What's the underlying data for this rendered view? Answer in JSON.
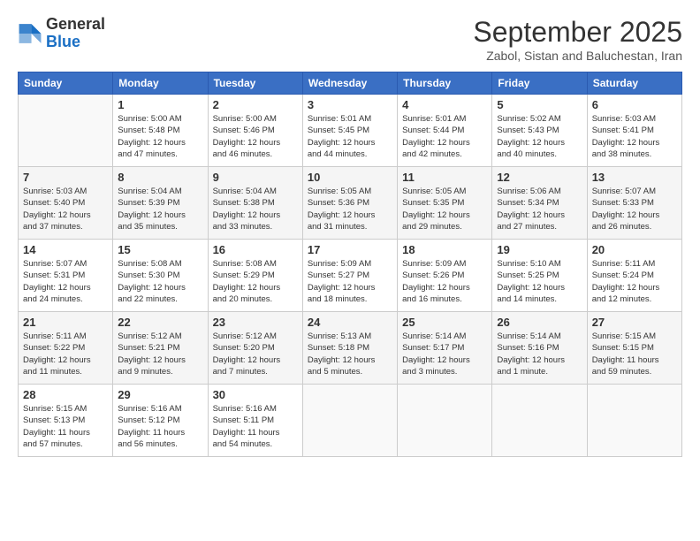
{
  "logo": {
    "line1": "General",
    "line2": "Blue"
  },
  "title": "September 2025",
  "location": "Zabol, Sistan and Baluchestan, Iran",
  "weekdays": [
    "Sunday",
    "Monday",
    "Tuesday",
    "Wednesday",
    "Thursday",
    "Friday",
    "Saturday"
  ],
  "weeks": [
    [
      {
        "day": "",
        "info": ""
      },
      {
        "day": "1",
        "info": "Sunrise: 5:00 AM\nSunset: 5:48 PM\nDaylight: 12 hours\nand 47 minutes."
      },
      {
        "day": "2",
        "info": "Sunrise: 5:00 AM\nSunset: 5:46 PM\nDaylight: 12 hours\nand 46 minutes."
      },
      {
        "day": "3",
        "info": "Sunrise: 5:01 AM\nSunset: 5:45 PM\nDaylight: 12 hours\nand 44 minutes."
      },
      {
        "day": "4",
        "info": "Sunrise: 5:01 AM\nSunset: 5:44 PM\nDaylight: 12 hours\nand 42 minutes."
      },
      {
        "day": "5",
        "info": "Sunrise: 5:02 AM\nSunset: 5:43 PM\nDaylight: 12 hours\nand 40 minutes."
      },
      {
        "day": "6",
        "info": "Sunrise: 5:03 AM\nSunset: 5:41 PM\nDaylight: 12 hours\nand 38 minutes."
      }
    ],
    [
      {
        "day": "7",
        "info": "Sunrise: 5:03 AM\nSunset: 5:40 PM\nDaylight: 12 hours\nand 37 minutes."
      },
      {
        "day": "8",
        "info": "Sunrise: 5:04 AM\nSunset: 5:39 PM\nDaylight: 12 hours\nand 35 minutes."
      },
      {
        "day": "9",
        "info": "Sunrise: 5:04 AM\nSunset: 5:38 PM\nDaylight: 12 hours\nand 33 minutes."
      },
      {
        "day": "10",
        "info": "Sunrise: 5:05 AM\nSunset: 5:36 PM\nDaylight: 12 hours\nand 31 minutes."
      },
      {
        "day": "11",
        "info": "Sunrise: 5:05 AM\nSunset: 5:35 PM\nDaylight: 12 hours\nand 29 minutes."
      },
      {
        "day": "12",
        "info": "Sunrise: 5:06 AM\nSunset: 5:34 PM\nDaylight: 12 hours\nand 27 minutes."
      },
      {
        "day": "13",
        "info": "Sunrise: 5:07 AM\nSunset: 5:33 PM\nDaylight: 12 hours\nand 26 minutes."
      }
    ],
    [
      {
        "day": "14",
        "info": "Sunrise: 5:07 AM\nSunset: 5:31 PM\nDaylight: 12 hours\nand 24 minutes."
      },
      {
        "day": "15",
        "info": "Sunrise: 5:08 AM\nSunset: 5:30 PM\nDaylight: 12 hours\nand 22 minutes."
      },
      {
        "day": "16",
        "info": "Sunrise: 5:08 AM\nSunset: 5:29 PM\nDaylight: 12 hours\nand 20 minutes."
      },
      {
        "day": "17",
        "info": "Sunrise: 5:09 AM\nSunset: 5:27 PM\nDaylight: 12 hours\nand 18 minutes."
      },
      {
        "day": "18",
        "info": "Sunrise: 5:09 AM\nSunset: 5:26 PM\nDaylight: 12 hours\nand 16 minutes."
      },
      {
        "day": "19",
        "info": "Sunrise: 5:10 AM\nSunset: 5:25 PM\nDaylight: 12 hours\nand 14 minutes."
      },
      {
        "day": "20",
        "info": "Sunrise: 5:11 AM\nSunset: 5:24 PM\nDaylight: 12 hours\nand 12 minutes."
      }
    ],
    [
      {
        "day": "21",
        "info": "Sunrise: 5:11 AM\nSunset: 5:22 PM\nDaylight: 12 hours\nand 11 minutes."
      },
      {
        "day": "22",
        "info": "Sunrise: 5:12 AM\nSunset: 5:21 PM\nDaylight: 12 hours\nand 9 minutes."
      },
      {
        "day": "23",
        "info": "Sunrise: 5:12 AM\nSunset: 5:20 PM\nDaylight: 12 hours\nand 7 minutes."
      },
      {
        "day": "24",
        "info": "Sunrise: 5:13 AM\nSunset: 5:18 PM\nDaylight: 12 hours\nand 5 minutes."
      },
      {
        "day": "25",
        "info": "Sunrise: 5:14 AM\nSunset: 5:17 PM\nDaylight: 12 hours\nand 3 minutes."
      },
      {
        "day": "26",
        "info": "Sunrise: 5:14 AM\nSunset: 5:16 PM\nDaylight: 12 hours\nand 1 minute."
      },
      {
        "day": "27",
        "info": "Sunrise: 5:15 AM\nSunset: 5:15 PM\nDaylight: 11 hours\nand 59 minutes."
      }
    ],
    [
      {
        "day": "28",
        "info": "Sunrise: 5:15 AM\nSunset: 5:13 PM\nDaylight: 11 hours\nand 57 minutes."
      },
      {
        "day": "29",
        "info": "Sunrise: 5:16 AM\nSunset: 5:12 PM\nDaylight: 11 hours\nand 56 minutes."
      },
      {
        "day": "30",
        "info": "Sunrise: 5:16 AM\nSunset: 5:11 PM\nDaylight: 11 hours\nand 54 minutes."
      },
      {
        "day": "",
        "info": ""
      },
      {
        "day": "",
        "info": ""
      },
      {
        "day": "",
        "info": ""
      },
      {
        "day": "",
        "info": ""
      }
    ]
  ]
}
